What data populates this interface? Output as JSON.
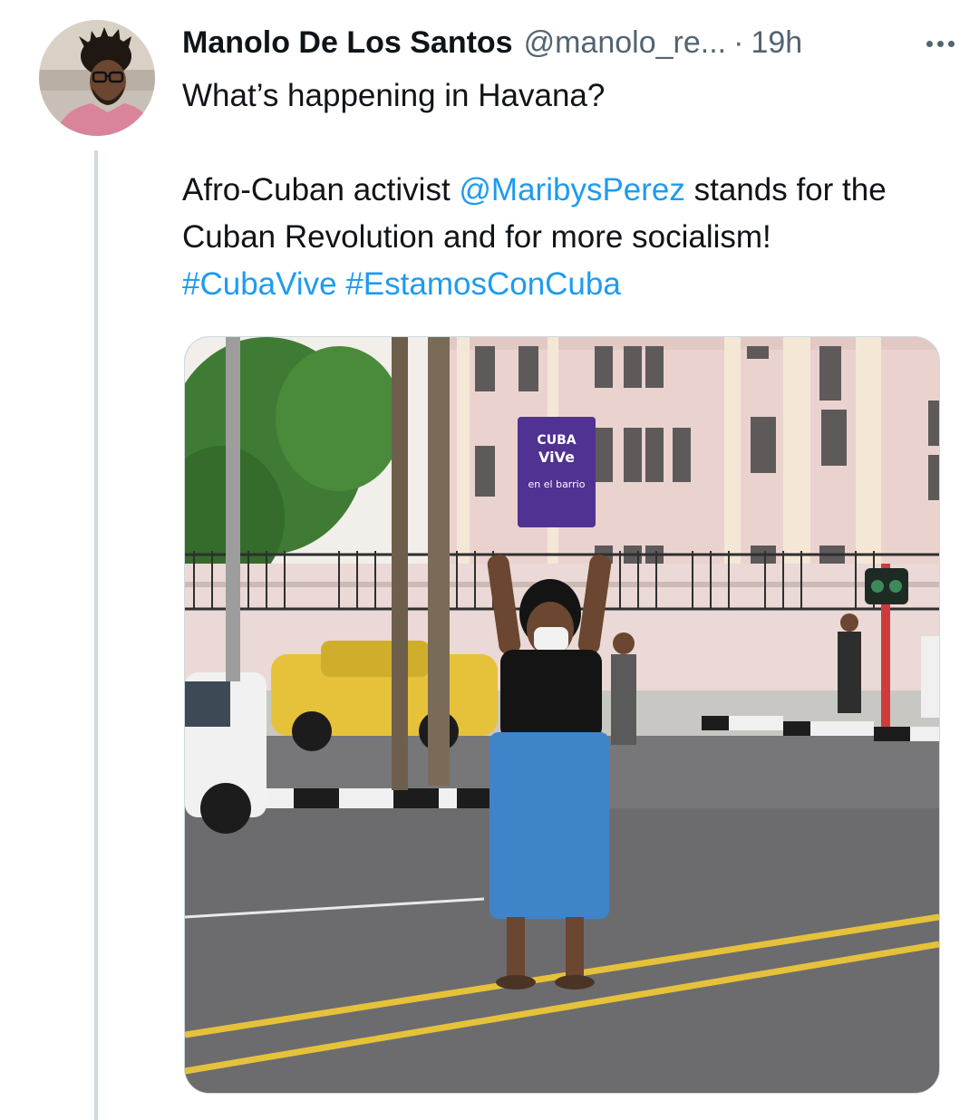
{
  "tweet": {
    "author_name": "Manolo De Los Santos",
    "author_handle": "@manolo_re...",
    "separator": "·",
    "time": "19h",
    "line1": "What’s happening in Havana?",
    "line2_before": "Afro-Cuban activist ",
    "mention": "@MaribysPerez",
    "line2_after": " stands for the Cuban Revolution and for more socialism!",
    "hashtag1": "#CubaVive",
    "hashtag2": "#EstamosConCuba"
  },
  "photo": {
    "sign_line1": "CUBA",
    "sign_line2": "ViVe",
    "sign_line3": "en el barrio"
  },
  "colors": {
    "link": "#1d9bf0",
    "secondary_text": "#536471",
    "thread_line": "#cfd9de"
  },
  "icons": {
    "more": "more-horizontal-icon"
  }
}
